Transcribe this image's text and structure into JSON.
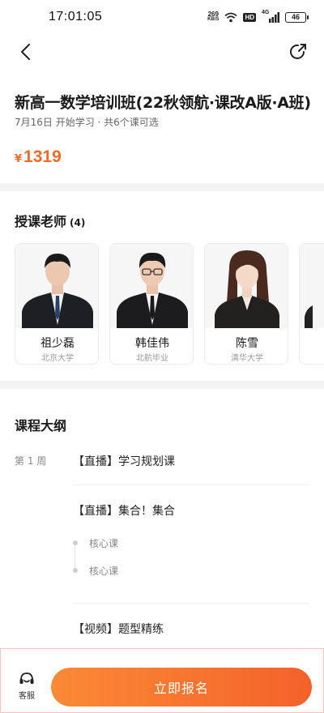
{
  "status_bar": {
    "time": "17:01:05",
    "net_speed_value": "269",
    "net_speed_unit": "KB/S",
    "hd_label": "HD",
    "signal_label": "4G",
    "battery": "46"
  },
  "header": {
    "back_icon": "chevron-left-icon",
    "share_icon": "share-icon"
  },
  "course": {
    "title": "新高一数学培训班(22秋领航·课改A版·A班)",
    "subtitle": "7月16日 开始学习 · 共6个课可选",
    "price_symbol": "¥",
    "price": "1319",
    "price_color": "#f26a2b"
  },
  "teachers": {
    "title": "授课老师",
    "count": "(4)",
    "items": [
      {
        "name": "祖少磊",
        "school": "北京大学"
      },
      {
        "name": "韩佳伟",
        "school": "北航毕业"
      },
      {
        "name": "陈雪",
        "school": "清华大学"
      }
    ]
  },
  "outline": {
    "title": "课程大纲",
    "week_label": "第 1 周",
    "lessons": [
      "【直播】学习规划课",
      "【直播】集合！集合",
      "【视频】题型精练"
    ],
    "sub_lessons": [
      "核心课",
      "核心课"
    ]
  },
  "bottom_bar": {
    "service_label": "客服",
    "service_icon": "customer-service-icon",
    "signup_label": "立即报名",
    "accent_start": "#fb8a36",
    "accent_end": "#f4622a"
  }
}
